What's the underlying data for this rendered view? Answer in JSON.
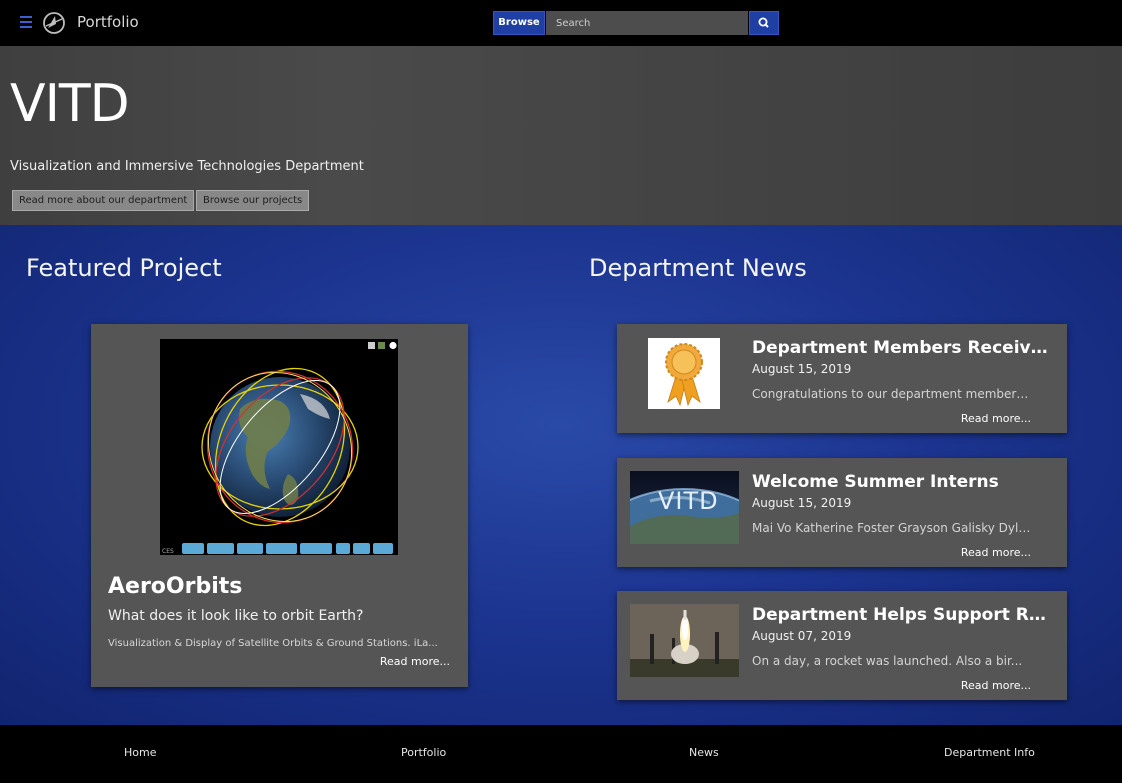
{
  "navbar": {
    "brand": "Portfolio",
    "browse_label": "Browse",
    "search_placeholder": "Search"
  },
  "hero": {
    "title": "VITD",
    "subtitle": "Visualization and Immersive Technologies Department",
    "buttons": [
      "Read more about our department",
      "Browse our projects"
    ]
  },
  "featured": {
    "section_title": "Featured Project",
    "name": "AeroOrbits",
    "tagline": "What does it look like to orbit Earth?",
    "description": "Visualization & Display of Satellite Orbits & Ground Stations. iLa...",
    "read_more": "Read more..."
  },
  "news": {
    "section_title": "Department News",
    "items": [
      {
        "title": "Department Members Receive ...",
        "date": "August 15, 2019",
        "excerpt": "Congratulations to our department members...",
        "read_more": "Read more...",
        "thumb_icon": "award-ribbon-icon"
      },
      {
        "title": "Welcome Summer Interns",
        "date": "August 15, 2019",
        "excerpt": "Mai Vo Katherine Foster Grayson Galisky Dyla...",
        "read_more": "Read more...",
        "thumb_icon": "earth-vitd-image",
        "thumb_text": "VITD"
      },
      {
        "title": "Department Helps Support Roc...",
        "date": "August 07, 2019",
        "excerpt": "On a day, a rocket was launched. Also a bir...",
        "read_more": "Read more...",
        "thumb_icon": "rocket-launch-image"
      }
    ]
  },
  "footer": {
    "links": [
      "Home",
      "Portfolio",
      "News",
      "Department Info"
    ]
  },
  "colors": {
    "accent": "#1f3fa3",
    "main_bg": "#1c3590",
    "card_bg": "#555555",
    "hero_bg": "#444444"
  }
}
